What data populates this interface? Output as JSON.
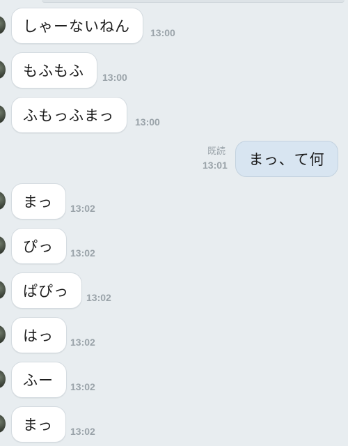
{
  "messages_received_1": [
    {
      "text": "しゃーないねん",
      "time": "13:00"
    },
    {
      "text": "もふもふ",
      "time": "13:00"
    },
    {
      "text": "ふもっふまっ",
      "time": "13:00"
    }
  ],
  "sent_message": {
    "text": "まっ、て何",
    "time": "13:01",
    "read_label": "既読"
  },
  "messages_received_2": [
    {
      "text": "まっ",
      "time": "13:02"
    },
    {
      "text": "ぴっ",
      "time": "13:02"
    },
    {
      "text": "ぱぴっ",
      "time": "13:02"
    },
    {
      "text": "はっ",
      "time": "13:02"
    },
    {
      "text": "ふー",
      "time": "13:02"
    },
    {
      "text": "まっ",
      "time": "13:02"
    }
  ],
  "colors": {
    "background": "#e8edf0",
    "received_bubble": "#ffffff",
    "sent_bubble": "#d8e5f1",
    "timestamp": "#9aa3a9"
  }
}
